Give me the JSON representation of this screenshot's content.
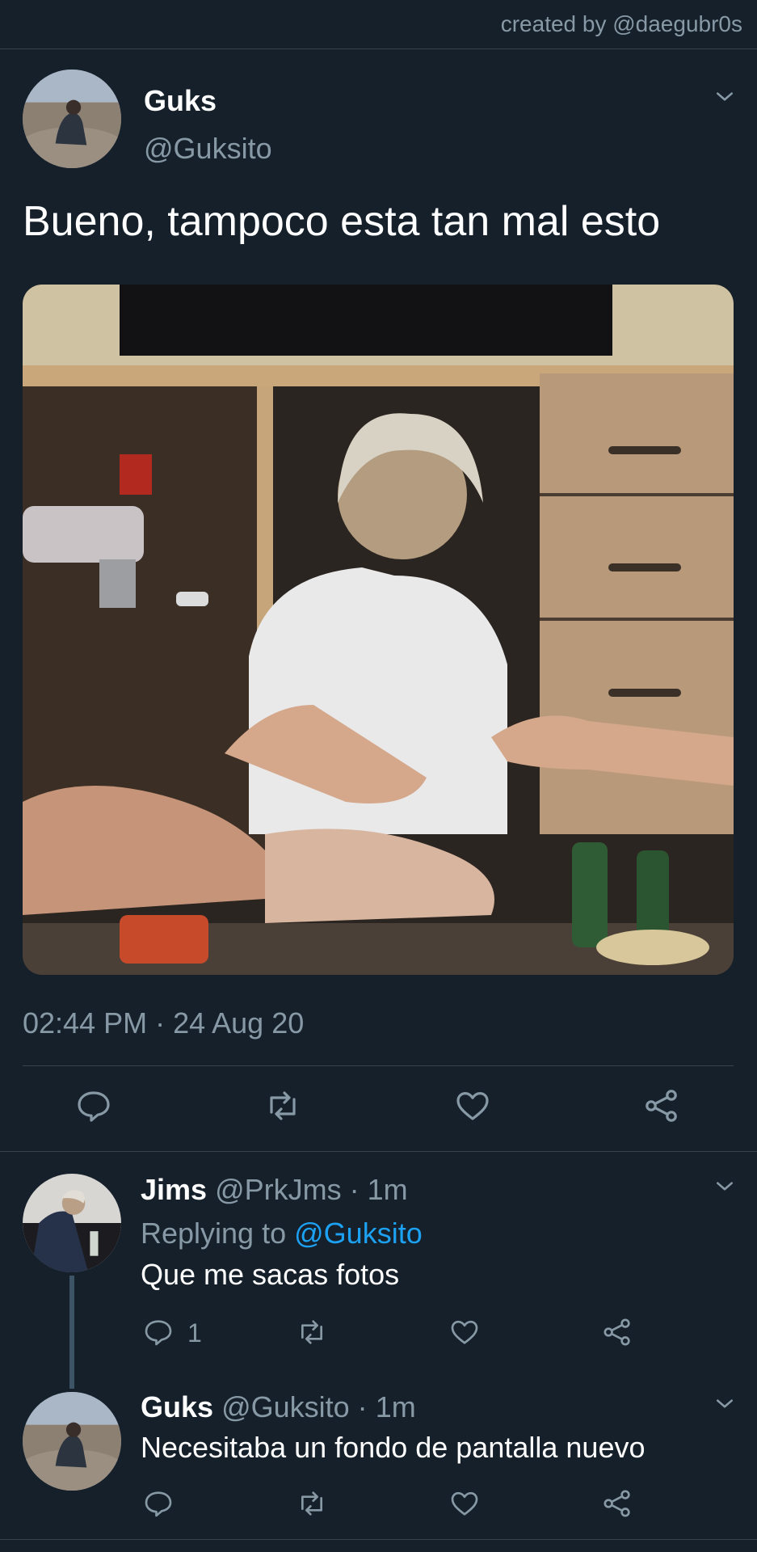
{
  "header": {
    "credit": "created by @daegubr0s"
  },
  "tweet": {
    "display_name": "Guks",
    "handle": "@Guksito",
    "text": "Bueno, tampoco esta tan mal esto",
    "timestamp": "02:44 PM · 24 Aug 20"
  },
  "replies": [
    {
      "display_name": "Jims",
      "handle": "@PrkJms",
      "separator": "·",
      "time": "1m",
      "replying_label": "Replying to",
      "replying_handle": "@Guksito",
      "text": "Que me sacas fotos",
      "reply_count": "1"
    },
    {
      "display_name": "Guks",
      "handle": "@Guksito",
      "separator": "·",
      "time": "1m",
      "text": "Necesitaba un fondo de pantalla nuevo"
    }
  ],
  "icons": {
    "reply": "speech-bubble-icon",
    "retweet": "retweet-arrows-icon",
    "like": "heart-icon",
    "share": "share-nodes-icon",
    "menu": "chevron-down-icon"
  },
  "colors": {
    "background": "#15202b",
    "divider": "#38444d",
    "muted_text": "#8899a6",
    "link": "#1da1f2",
    "thread_line": "#3d5466"
  }
}
